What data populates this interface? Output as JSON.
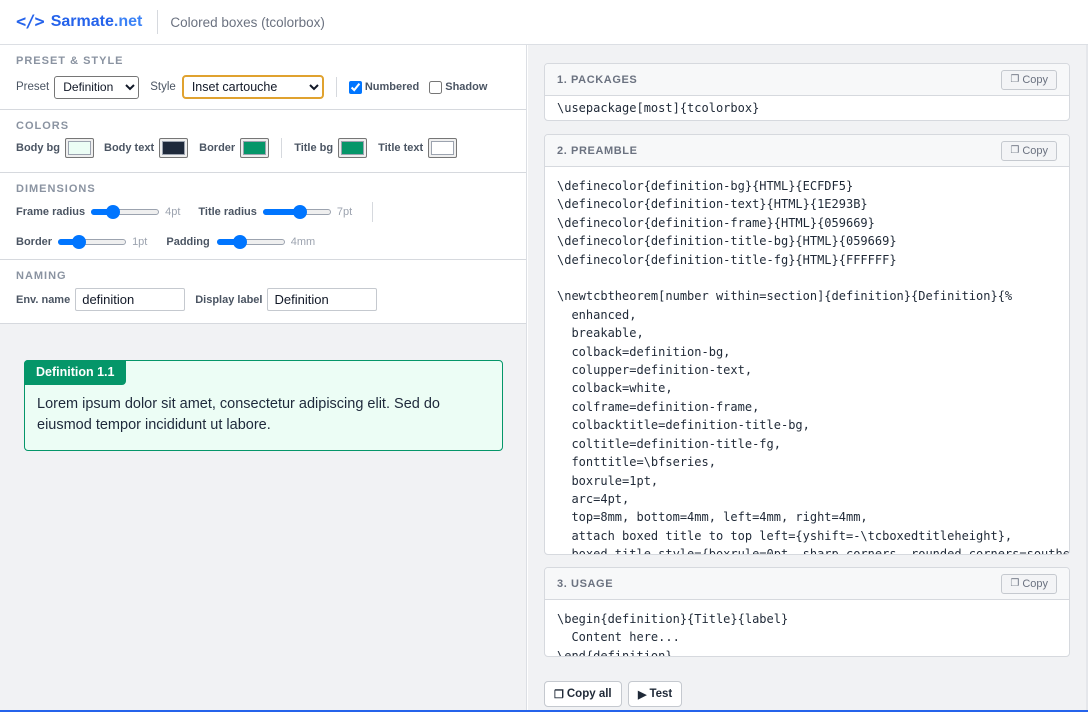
{
  "header": {
    "brand_icon": "</>",
    "brand_name": "Sarmate",
    "brand_tld": ".net",
    "page_title": "Colored boxes (tcolorbox)"
  },
  "preset_style": {
    "title": "PRESET & STYLE",
    "preset_label": "Preset",
    "preset_value": "Definition",
    "style_label": "Style",
    "style_value": "Inset cartouche",
    "numbered_label": "Numbered",
    "numbered_checked": true,
    "shadow_label": "Shadow",
    "shadow_checked": false
  },
  "colors": {
    "title": "COLORS",
    "body_bg_label": "Body bg",
    "body_bg": "#ECFDF5",
    "body_text_label": "Body text",
    "body_text": "#1E293B",
    "border_label": "Border",
    "border": "#059669",
    "title_bg_label": "Title bg",
    "title_bg": "#059669",
    "title_text_label": "Title text",
    "title_text": "#FFFFFF"
  },
  "dimensions": {
    "title": "DIMENSIONS",
    "frame_radius_label": "Frame radius",
    "frame_radius_value": "4pt",
    "frame_radius_fraction": 0.27,
    "title_radius_label": "Title radius",
    "title_radius_value": "7pt",
    "title_radius_fraction": 0.55,
    "border_label": "Border",
    "border_value": "1pt",
    "border_fraction": 0.25,
    "padding_label": "Padding",
    "padding_value": "4mm",
    "padding_fraction": 0.3
  },
  "naming": {
    "title": "NAMING",
    "env_label": "Env. name",
    "env_value": "definition",
    "display_label": "Display label",
    "display_value": "Definition"
  },
  "preview": {
    "title": "Definition 1.1",
    "body": "Lorem ipsum dolor sit amet, consectetur adipiscing elit. Sed do eiusmod tempor incididunt ut labore."
  },
  "cards": {
    "packages": {
      "title": "1. PACKAGES",
      "copy_label": "Copy",
      "code": "\\usepackage[most]{tcolorbox}"
    },
    "preamble": {
      "title": "2. PREAMBLE",
      "copy_label": "Copy",
      "code": "\\definecolor{definition-bg}{HTML}{ECFDF5}\n\\definecolor{definition-text}{HTML}{1E293B}\n\\definecolor{definition-frame}{HTML}{059669}\n\\definecolor{definition-title-bg}{HTML}{059669}\n\\definecolor{definition-title-fg}{HTML}{FFFFFF}\n\n\\newtcbtheorem[number within=section]{definition}{Definition}{%\n  enhanced,\n  breakable,\n  colback=definition-bg,\n  colupper=definition-text,\n  colback=white,\n  colframe=definition-frame,\n  colbacktitle=definition-title-bg,\n  coltitle=definition-title-fg,\n  fonttitle=\\bfseries,\n  boxrule=1pt,\n  arc=4pt,\n  top=8mm, bottom=4mm, left=4mm, right=4mm,\n  attach boxed title to top left={yshift=-\\tcboxedtitleheight},\n  boxed title style={boxrule=0pt, sharp corners, rounded corners=southea"
    },
    "usage": {
      "title": "3. USAGE",
      "copy_label": "Copy",
      "code": "\\begin{definition}{Title}{label}\n  Content here...\n\\end{definition}"
    }
  },
  "footer": {
    "copy_all_label": "Copy all",
    "test_label": "Test"
  }
}
